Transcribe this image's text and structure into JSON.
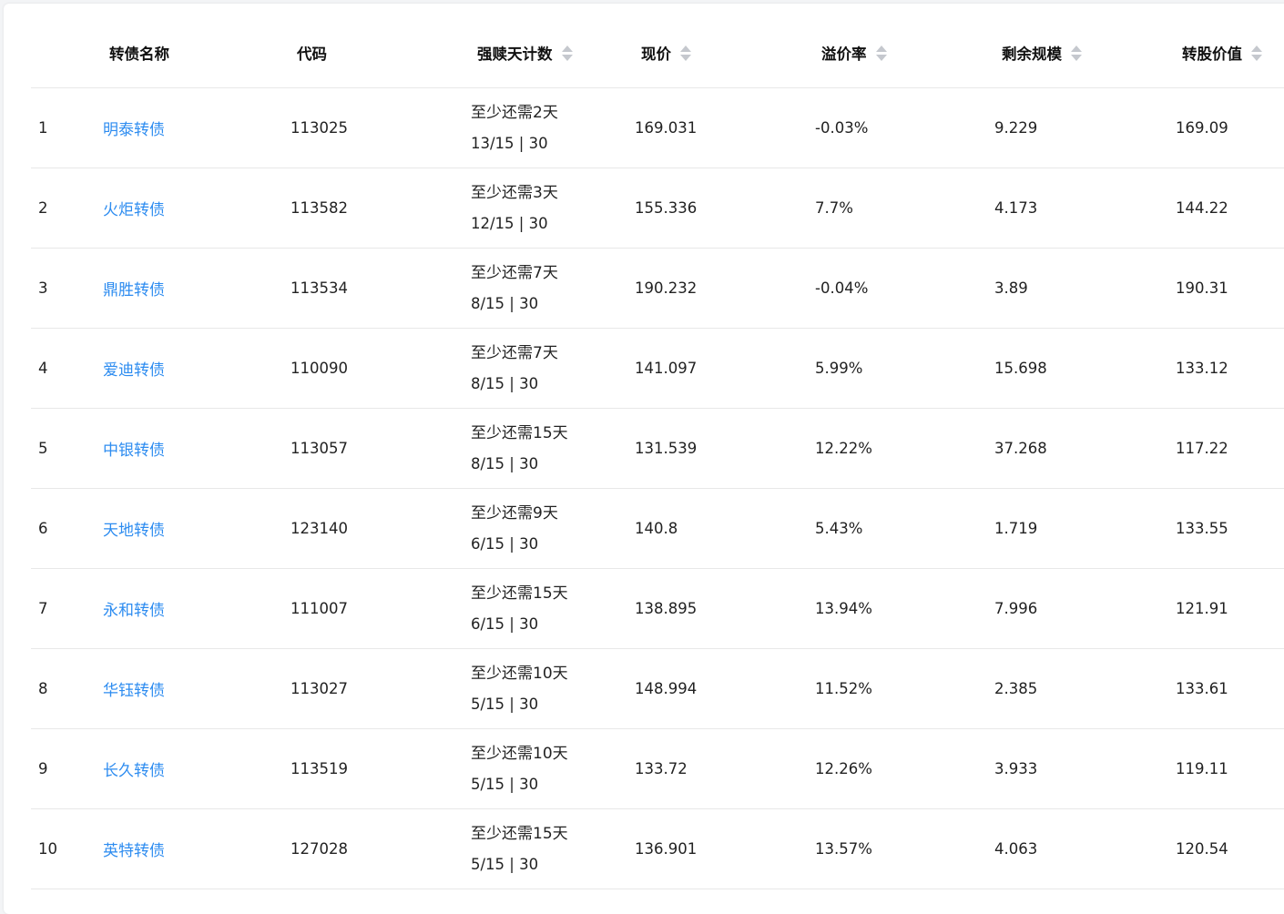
{
  "colors": {
    "link": "#2d8cf0",
    "sort_icon": "#c5c8ce",
    "border": "#e8e8e8"
  },
  "header": {
    "name": "转债名称",
    "code": "代码",
    "days": "强赎天计数",
    "price": "现价",
    "premium": "溢价率",
    "size": "剩余规模",
    "conv": "转股价值"
  },
  "rows": [
    {
      "idx": "1",
      "name": "明泰转债",
      "code": "113025",
      "days_line1": "至少还需2天",
      "days_line2": "13/15 | 30",
      "price": "169.031",
      "premium": "-0.03%",
      "size": "9.229",
      "conv": "169.09"
    },
    {
      "idx": "2",
      "name": "火炬转债",
      "code": "113582",
      "days_line1": "至少还需3天",
      "days_line2": "12/15 | 30",
      "price": "155.336",
      "premium": "7.7%",
      "size": "4.173",
      "conv": "144.22"
    },
    {
      "idx": "3",
      "name": "鼎胜转债",
      "code": "113534",
      "days_line1": "至少还需7天",
      "days_line2": "8/15 | 30",
      "price": "190.232",
      "premium": "-0.04%",
      "size": "3.89",
      "conv": "190.31"
    },
    {
      "idx": "4",
      "name": "爱迪转债",
      "code": "110090",
      "days_line1": "至少还需7天",
      "days_line2": "8/15 | 30",
      "price": "141.097",
      "premium": "5.99%",
      "size": "15.698",
      "conv": "133.12"
    },
    {
      "idx": "5",
      "name": "中银转债",
      "code": "113057",
      "days_line1": "至少还需15天",
      "days_line2": "8/15 | 30",
      "price": "131.539",
      "premium": "12.22%",
      "size": "37.268",
      "conv": "117.22"
    },
    {
      "idx": "6",
      "name": "天地转债",
      "code": "123140",
      "days_line1": "至少还需9天",
      "days_line2": "6/15 | 30",
      "price": "140.8",
      "premium": "5.43%",
      "size": "1.719",
      "conv": "133.55"
    },
    {
      "idx": "7",
      "name": "永和转债",
      "code": "111007",
      "days_line1": "至少还需15天",
      "days_line2": "6/15 | 30",
      "price": "138.895",
      "premium": "13.94%",
      "size": "7.996",
      "conv": "121.91"
    },
    {
      "idx": "8",
      "name": "华钰转债",
      "code": "113027",
      "days_line1": "至少还需10天",
      "days_line2": "5/15 | 30",
      "price": "148.994",
      "premium": "11.52%",
      "size": "2.385",
      "conv": "133.61"
    },
    {
      "idx": "9",
      "name": "长久转债",
      "code": "113519",
      "days_line1": "至少还需10天",
      "days_line2": "5/15 | 30",
      "price": "133.72",
      "premium": "12.26%",
      "size": "3.933",
      "conv": "119.11"
    },
    {
      "idx": "10",
      "name": "英特转债",
      "code": "127028",
      "days_line1": "至少还需15天",
      "days_line2": "5/15 | 30",
      "price": "136.901",
      "premium": "13.57%",
      "size": "4.063",
      "conv": "120.54"
    }
  ]
}
